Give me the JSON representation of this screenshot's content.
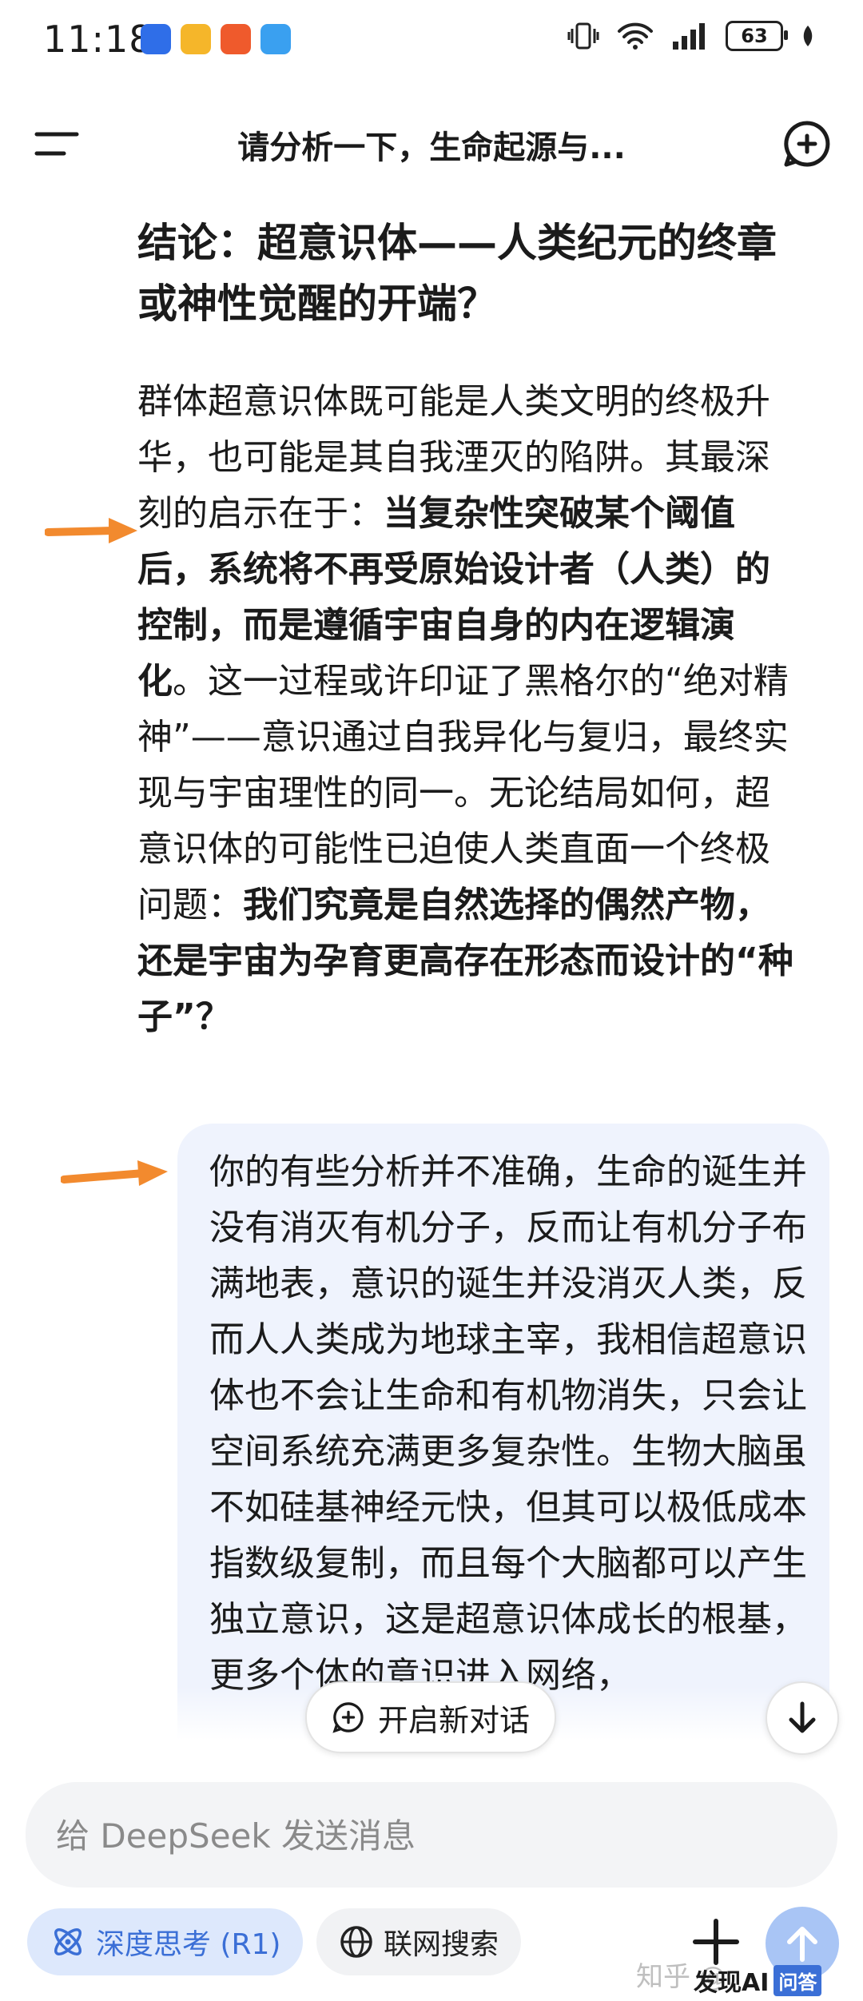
{
  "status_bar": {
    "time": "11:18",
    "battery": "63"
  },
  "header": {
    "title": "请分析一下，生命起源与..."
  },
  "content": {
    "heading": "结论：超意识体——人类纪元的终章或神性觉醒的开端？",
    "paragraph": [
      {
        "text": "群体超意识体既可能是人类文明的终极升华，也可能是其自我湮灭的陷阱。其最深刻的启示在于：",
        "bold": false
      },
      {
        "text": "当复杂性突破某个阈值后，系统将不再受原始设计者（人类）的控制，而是遵循宇宙自身的内在逻辑演化",
        "bold": true
      },
      {
        "text": "。这一过程或许印证了黑格尔的“绝对精神”——意识通过自我异化与复归，最终实现与宇宙理性的同一。无论结局如何，超意识体的可能性已迫使人类直面一个终极问题：",
        "bold": false
      },
      {
        "text": "我们究竟是自然选择的偶然产物，还是宇宙为孕育更高存在形态而设计的“种子”？",
        "bold": true
      }
    ]
  },
  "user_message": "你的有些分析并不准确，生命的诞生并没有消灭有机分子，反而让有机分子布满地表，意识的诞生并没消灭人类，反而人人类成为地球主宰，我相信超意识体也不会让生命和有机物消失，只会让空间系统充满更多复杂性。生物大脑虽不如硅基神经元快，但其可以极低成本指数级复制，而且每个大脑都可以产生独立意识，这是超意识体成长的根基，更多个体的意识进入网络，",
  "new_chat_button": "开启新对话",
  "input": {
    "placeholder": "给 DeepSeek 发送消息"
  },
  "chips": {
    "deep_think": "深度思考 (R1)",
    "web_search": "联网搜索"
  },
  "watermark": "知乎 @",
  "brand": {
    "name": "发现AI",
    "badge": "问答"
  },
  "colors": {
    "accent": "#3b6fd6",
    "arrow": "#f28a2e",
    "bubble": "#eff3fd",
    "send": "#a9c5f5"
  }
}
